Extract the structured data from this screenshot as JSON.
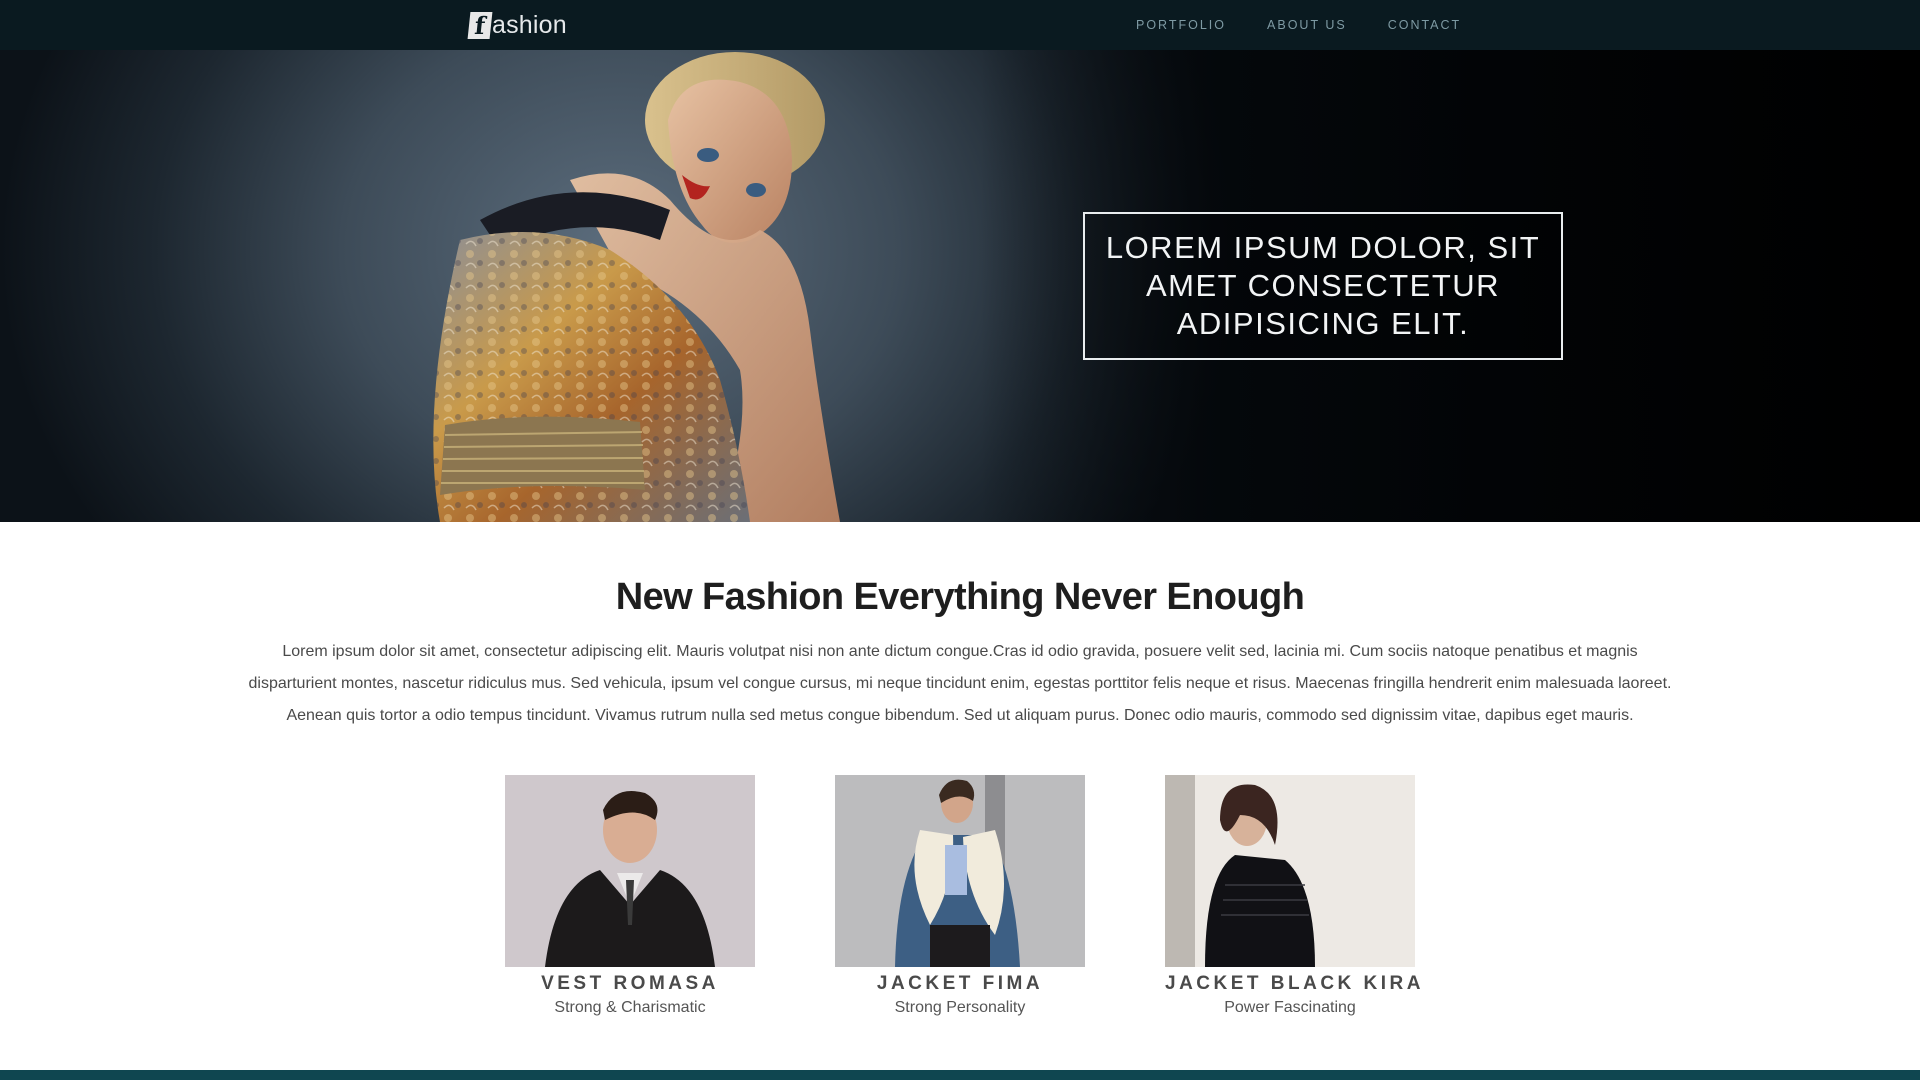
{
  "nav": {
    "brand_mark": "f",
    "brand_text": "ashion",
    "links": [
      {
        "label": "PORTFOLIO"
      },
      {
        "label": "ABOUT US"
      },
      {
        "label": "CONTACT"
      }
    ]
  },
  "hero": {
    "caption": "LOREM IPSUM DOLOR, SIT AMET CONSECTETUR ADIPISICING ELIT."
  },
  "intro": {
    "title": "New Fashion Everything Never Enough",
    "paragraph": "Lorem ipsum dolor sit amet, consectetur adipiscing elit. Mauris volutpat nisi non ante dictum congue.Cras id odio gravida, posuere velit sed, lacinia mi. Cum sociis natoque penatibus et magnis disparturient montes, nascetur ridiculus mus. Sed vehicula, ipsum vel congue cursus, mi neque tincidunt enim, egestas porttitor felis neque et risus. Maecenas fringilla hendrerit enim malesuada laoreet. Aenean quis tortor a odio tempus tincidunt. Vivamus rutrum nulla sed metus congue bibendum. Sed ut aliquam purus. Donec odio mauris, commodo sed dignissim vitae, dapibus eget mauris."
  },
  "products": [
    {
      "title": "VEST ROMASA",
      "subtitle": "Strong & Charismatic"
    },
    {
      "title": "JACKET FIMA",
      "subtitle": "Strong Personality"
    },
    {
      "title": "JACKET BLACK KIRA",
      "subtitle": "Power Fascinating"
    }
  ],
  "colors": {
    "nav_bg": "#0a1a20",
    "nav_link": "#7e9aa3",
    "footer_bar": "#0f4650"
  }
}
